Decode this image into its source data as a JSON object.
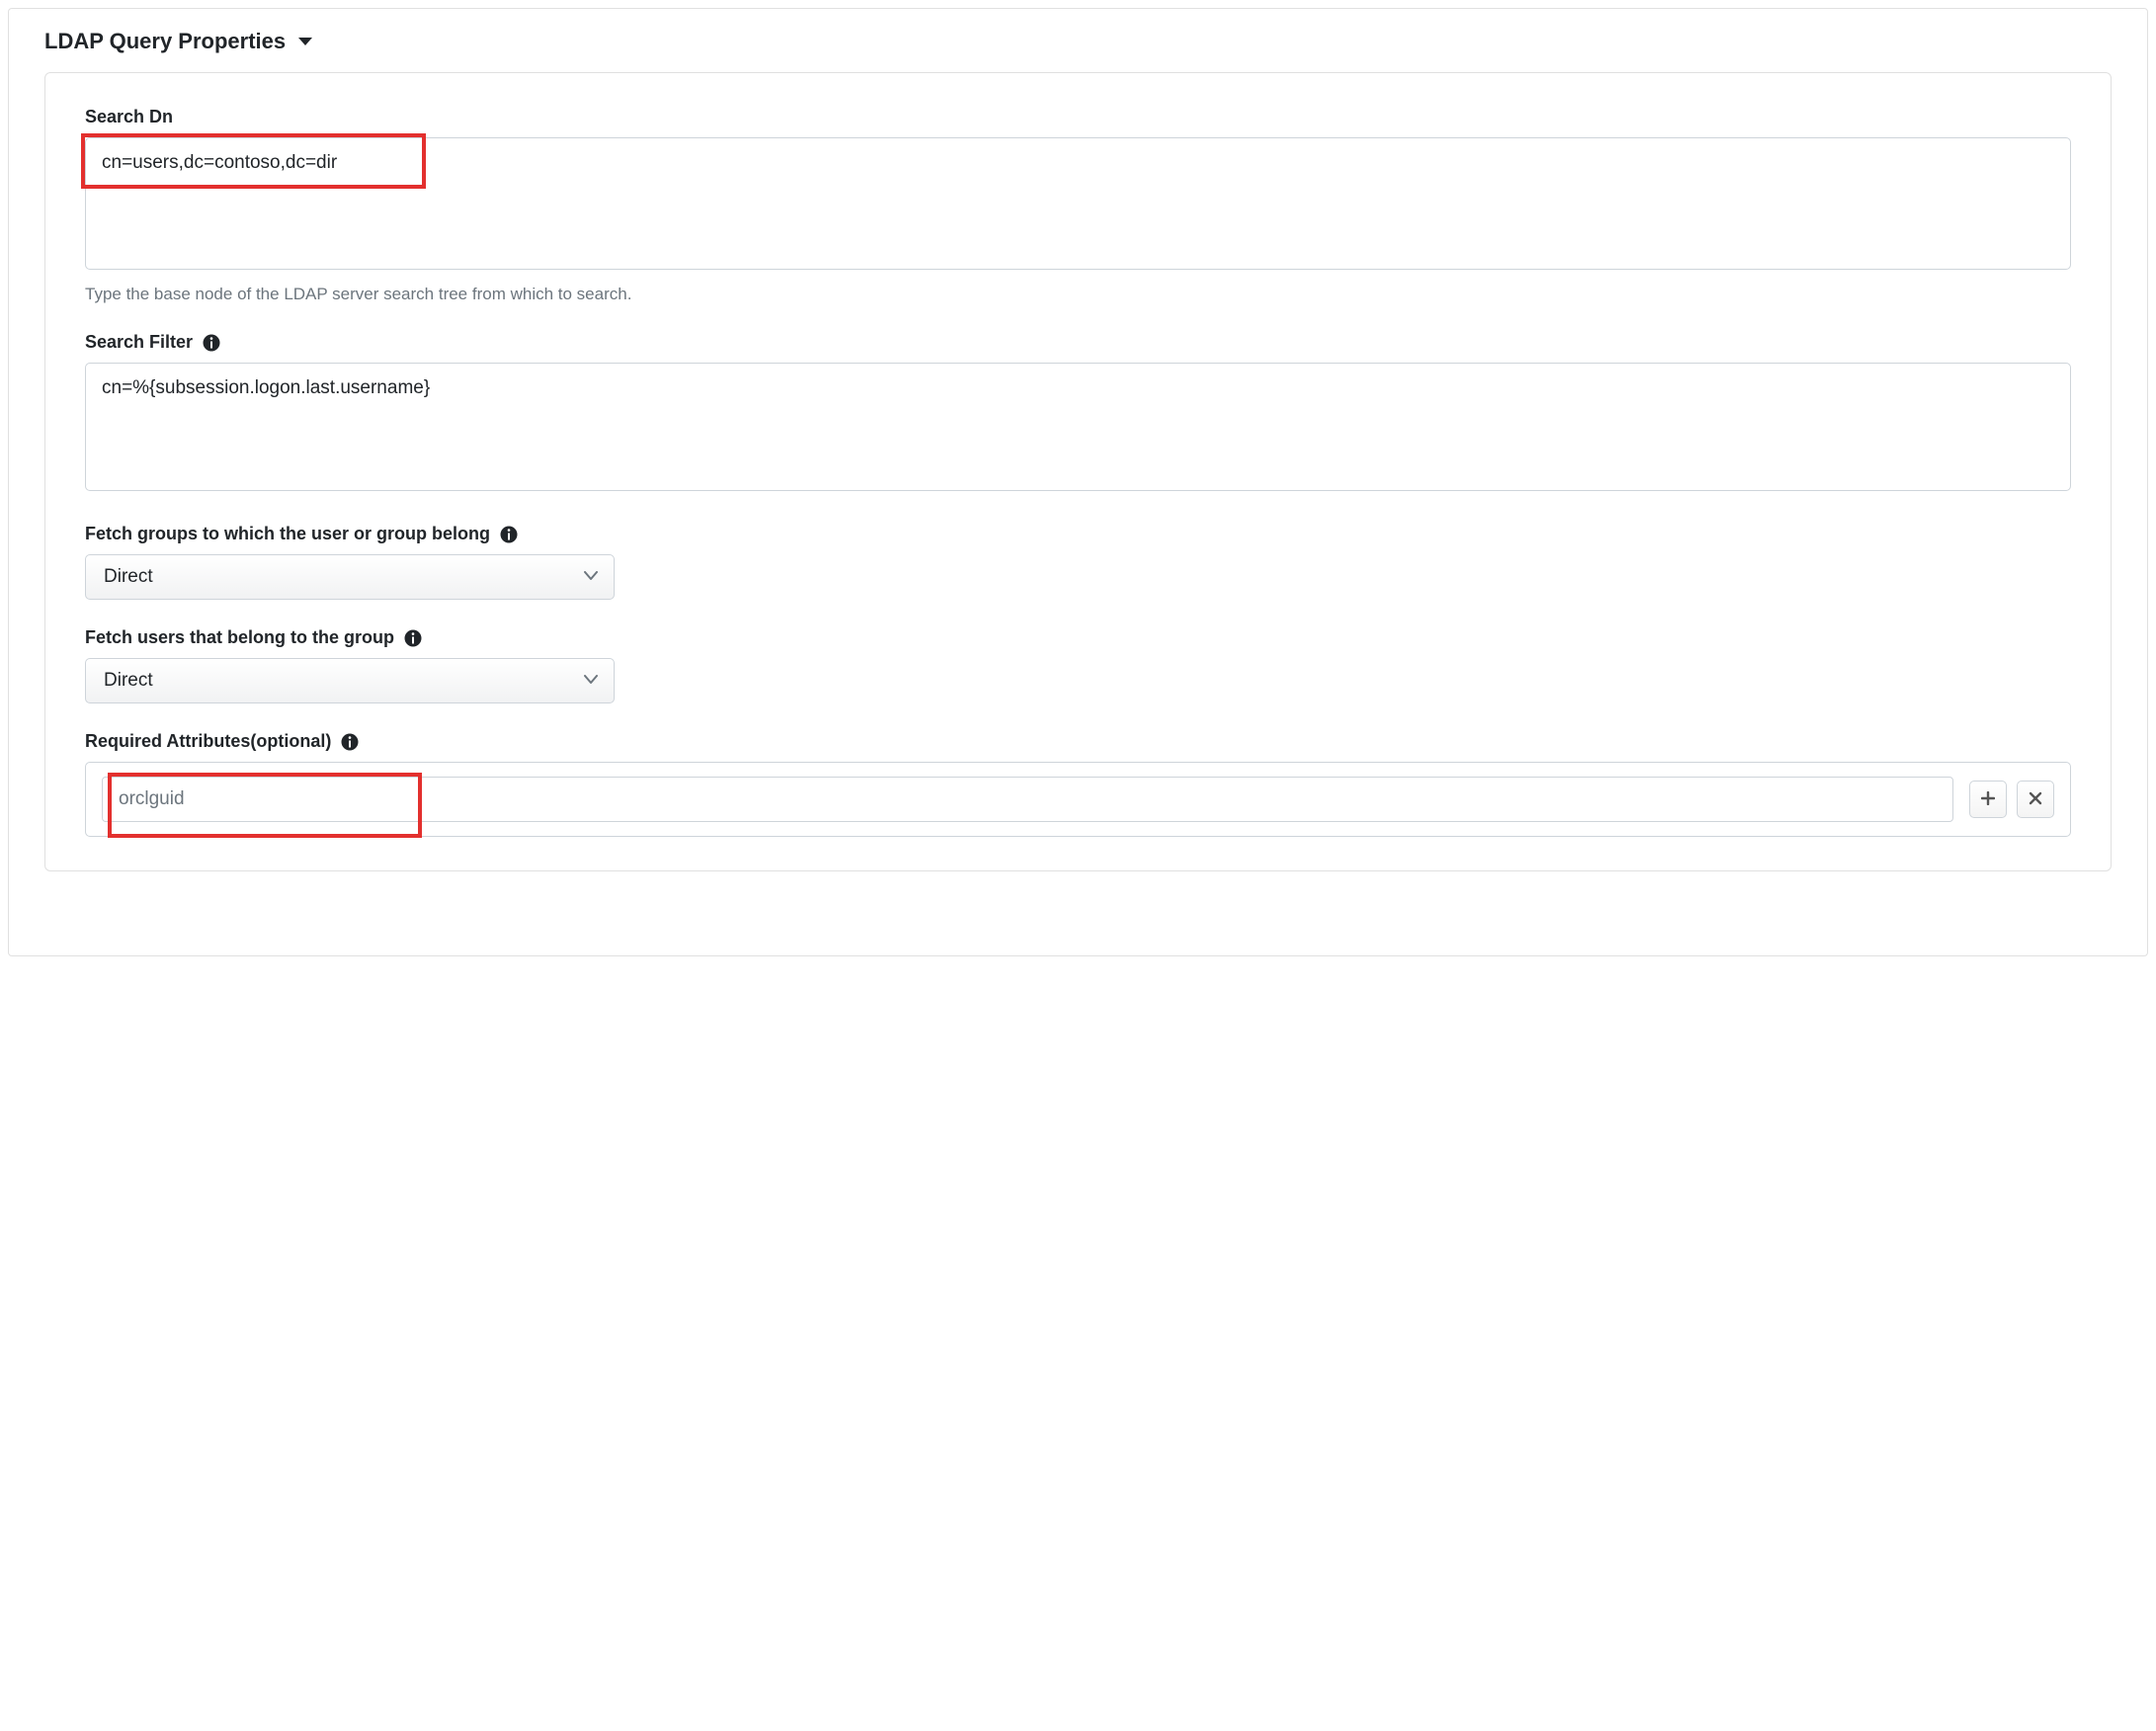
{
  "section": {
    "title": "LDAP Query Properties"
  },
  "searchDn": {
    "label": "Search Dn",
    "value": "cn=users,dc=contoso,dc=dir",
    "help": "Type the base node of the LDAP server search tree from which to search."
  },
  "searchFilter": {
    "label": "Search Filter",
    "value": "cn=%{subsession.logon.last.username}"
  },
  "fetchGroups": {
    "label": "Fetch groups to which the user or group belong",
    "value": "Direct"
  },
  "fetchUsers": {
    "label": "Fetch users that belong to the group",
    "value": "Direct"
  },
  "requiredAttrs": {
    "label": "Required Attributes(optional)",
    "placeholder": "orclguid"
  }
}
